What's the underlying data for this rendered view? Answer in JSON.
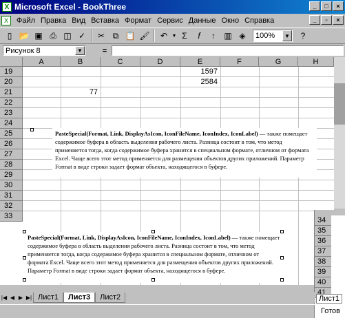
{
  "window": {
    "title": "Microsoft Excel - BookThree",
    "app_icon": "excel-icon"
  },
  "menu": [
    "Файл",
    "Правка",
    "Вид",
    "Вставка",
    "Формат",
    "Сервис",
    "Данные",
    "Окно",
    "Справка"
  ],
  "toolbar": {
    "zoom": "100%"
  },
  "formula_bar": {
    "name_box": "Рисунок 8",
    "equals": "=",
    "formula": ""
  },
  "columns": [
    "A",
    "B",
    "C",
    "D",
    "E",
    "F",
    "G",
    "H"
  ],
  "rows": [
    "19",
    "20",
    "21",
    "22",
    "23",
    "24",
    "25",
    "26",
    "27",
    "28",
    "29",
    "30",
    "31",
    "32",
    "33"
  ],
  "cells": {
    "E19": "1597",
    "E20": "2584",
    "B21": "77"
  },
  "ole1": {
    "bold": "PasteSpecial(Format, Link, DisplayAsIcon, IconFileName, IconIndex, IconLabel)",
    "text": " — также помещает содержимое буфера в область выделения рабочего листа. Разница состоит в том, что метод применяется тогда, когда содержимое буфера хранится в специальном формате, отличном от формата Excel. Чаще всего этот метод применяется для размещения объектов других приложений. Параметр Format в виде строки задает формат объекта, находящегося в буфере."
  },
  "ole2": {
    "bold": "PasteSpecial(Format, Link, DisplayAsIcon, IconFileName, IconIndex, IconLabel)",
    "text": " — также помещает содержимое буфера в область выделения рабочего листа. Разница состоит в том, что метод применяется тогда, когда содержимое буфера хранится в специальном формате, отличном от формата Excel. Чаще всего этот метод применяется для размещения объектов других приложений. Параметр Format в виде строки задает формат объекта, находящегося в буфере."
  },
  "sheets": [
    "Лист1",
    "Лист3",
    "Лист2"
  ],
  "active_sheet": "Лист3",
  "bg_rows": [
    "34",
    "35",
    "36",
    "37",
    "38",
    "39",
    "40",
    "41"
  ],
  "bg_tab": "Лист1",
  "status": "Готов"
}
